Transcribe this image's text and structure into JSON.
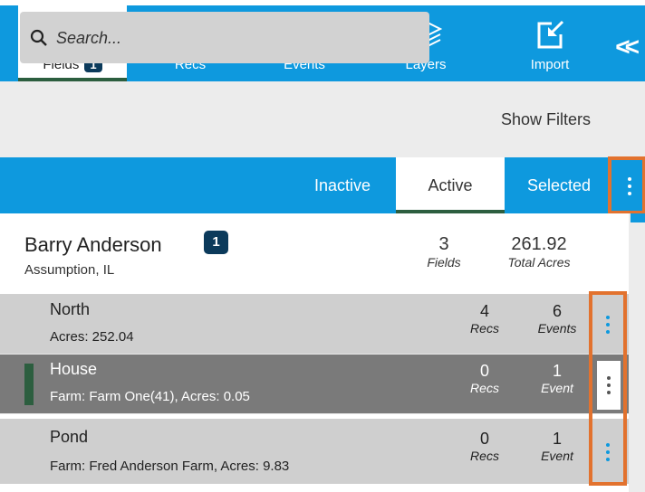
{
  "nav": {
    "tabs": [
      {
        "label": "Fields",
        "badge": "1",
        "icon": "fields-icon",
        "active": true
      },
      {
        "label": "Recs",
        "icon": "rx-icon"
      },
      {
        "label": "Events",
        "icon": "events-icon"
      },
      {
        "label": "Layers",
        "icon": "layers-icon"
      },
      {
        "label": "Import",
        "icon": "import-icon"
      }
    ],
    "collapse_glyph": "<<"
  },
  "search": {
    "placeholder": "Search...",
    "show_filters": "Show Filters"
  },
  "filters": {
    "tabs": [
      {
        "label": "Inactive"
      },
      {
        "label": "Active",
        "active": true
      },
      {
        "label": "Selected"
      }
    ]
  },
  "customer": {
    "name": "Barry Anderson",
    "badge": "1",
    "location": "Assumption, IL",
    "fields_count": "3",
    "fields_label": "Fields",
    "acres": "261.92",
    "acres_label": "Total Acres"
  },
  "fields": [
    {
      "name": "North",
      "detail": "Acres: 252.04",
      "recs": "4",
      "recs_label": "Recs",
      "events": "6",
      "events_label": "Events",
      "selected": false
    },
    {
      "name": "House",
      "detail": "Farm: Farm One(41), Acres: 0.05",
      "recs": "0",
      "recs_label": "Recs",
      "events": "1",
      "events_label": "Event",
      "selected": true
    },
    {
      "name": "Pond",
      "detail": "Farm: Fred Anderson Farm, Acres: 9.83",
      "recs": "0",
      "recs_label": "Recs",
      "events": "1",
      "events_label": "Event",
      "selected": false
    }
  ],
  "colors": {
    "accent_blue": "#0e99de",
    "highlight_orange": "#e2722e",
    "active_green": "#2c5e3f",
    "badge_navy": "#0b3a5b",
    "row_gray": "#cfcfcf",
    "row_selected": "#7a7a7a"
  }
}
